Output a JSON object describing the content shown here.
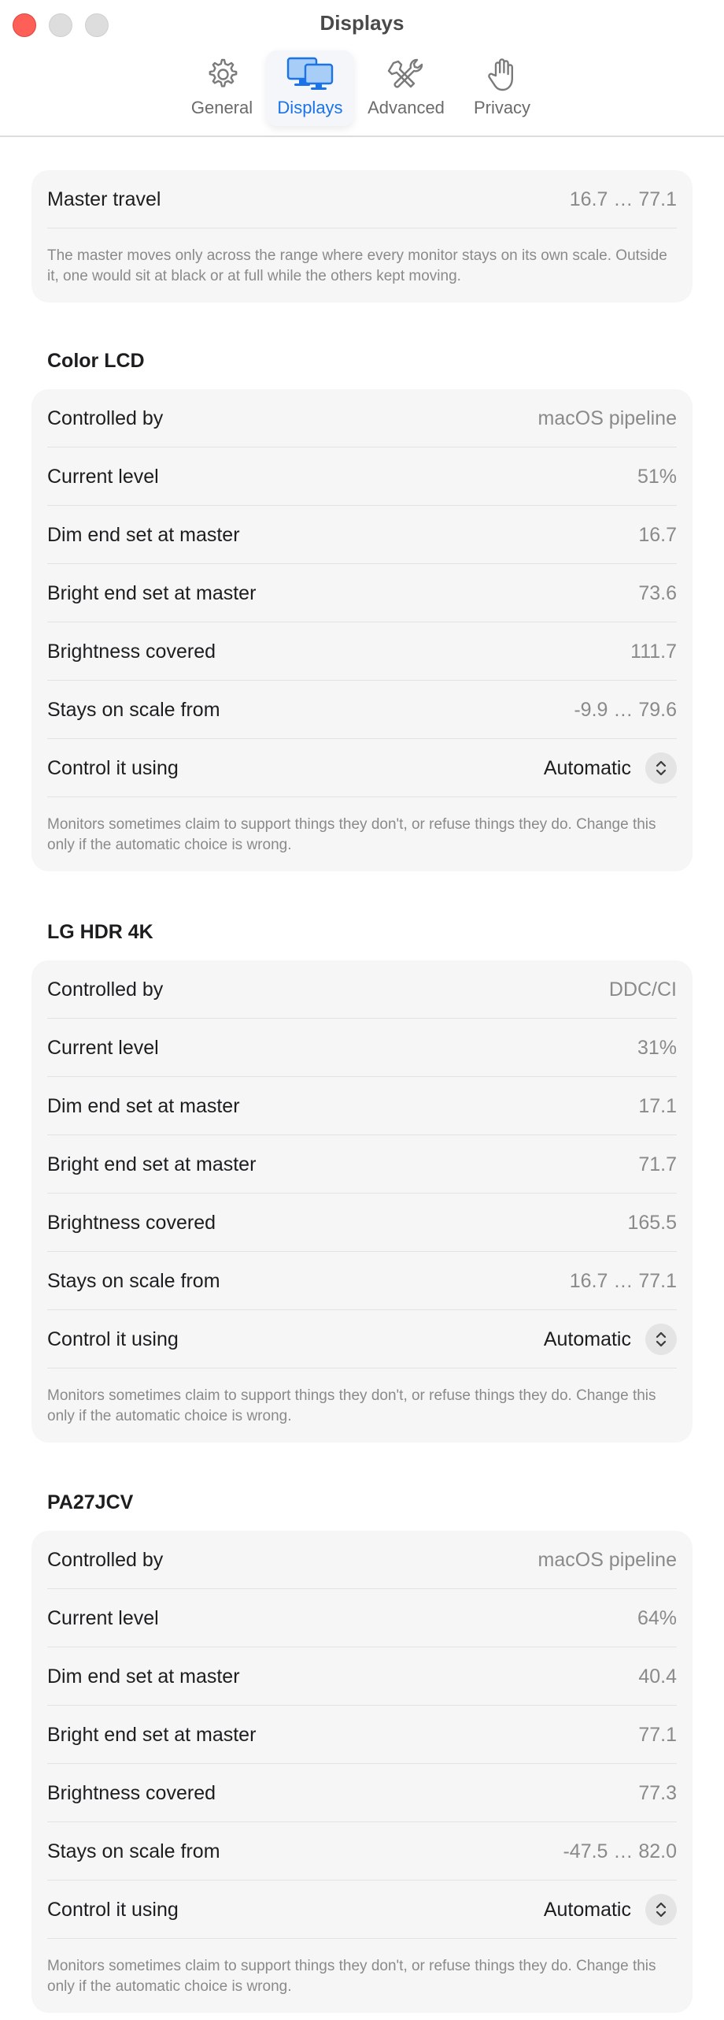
{
  "window": {
    "title": "Displays"
  },
  "tabs": [
    {
      "label": "General",
      "icon": "gear-icon",
      "active": false
    },
    {
      "label": "Displays",
      "icon": "displays-icon",
      "active": true
    },
    {
      "label": "Advanced",
      "icon": "tools-icon",
      "active": false
    },
    {
      "label": "Privacy",
      "icon": "hand-icon",
      "active": false
    }
  ],
  "master": {
    "label": "Master travel",
    "value": "16.7 … 77.1",
    "note": "The master moves only across the range where every monitor stays on its own scale. Outside it, one would sit at black or at full while the others kept moving."
  },
  "displays": [
    {
      "name": "Color LCD",
      "rows": [
        {
          "label": "Controlled by",
          "value": "macOS pipeline"
        },
        {
          "label": "Current level",
          "value": "51%"
        },
        {
          "label": "Dim end set at master",
          "value": "16.7"
        },
        {
          "label": "Bright end set at master",
          "value": "73.6"
        },
        {
          "label": "Brightness covered",
          "value": "111.7"
        },
        {
          "label": "Stays on scale from",
          "value": "-9.9 … 79.6"
        }
      ],
      "control_label": "Control it using",
      "control_value": "Automatic",
      "note": "Monitors sometimes claim to support things they don't, or refuse things they do. Change this only if the automatic choice is wrong."
    },
    {
      "name": "LG HDR 4K",
      "rows": [
        {
          "label": "Controlled by",
          "value": "DDC/CI"
        },
        {
          "label": "Current level",
          "value": "31%"
        },
        {
          "label": "Dim end set at master",
          "value": "17.1"
        },
        {
          "label": "Bright end set at master",
          "value": "71.7"
        },
        {
          "label": "Brightness covered",
          "value": "165.5"
        },
        {
          "label": "Stays on scale from",
          "value": "16.7 … 77.1"
        }
      ],
      "control_label": "Control it using",
      "control_value": "Automatic",
      "note": "Monitors sometimes claim to support things they don't, or refuse things they do. Change this only if the automatic choice is wrong."
    },
    {
      "name": "PA27JCV",
      "rows": [
        {
          "label": "Controlled by",
          "value": "macOS pipeline"
        },
        {
          "label": "Current level",
          "value": "64%"
        },
        {
          "label": "Dim end set at master",
          "value": "40.4"
        },
        {
          "label": "Bright end set at master",
          "value": "77.1"
        },
        {
          "label": "Brightness covered",
          "value": "77.3"
        },
        {
          "label": "Stays on scale from",
          "value": "-47.5 … 82.0"
        }
      ],
      "control_label": "Control it using",
      "control_value": "Automatic",
      "note": "Monitors sometimes claim to support things they don't, or refuse things they do. Change this only if the automatic choice is wrong."
    }
  ],
  "colors": {
    "accent": "#1a73e8",
    "close_button": "#fe5f57",
    "card_background": "#f6f6f6"
  }
}
